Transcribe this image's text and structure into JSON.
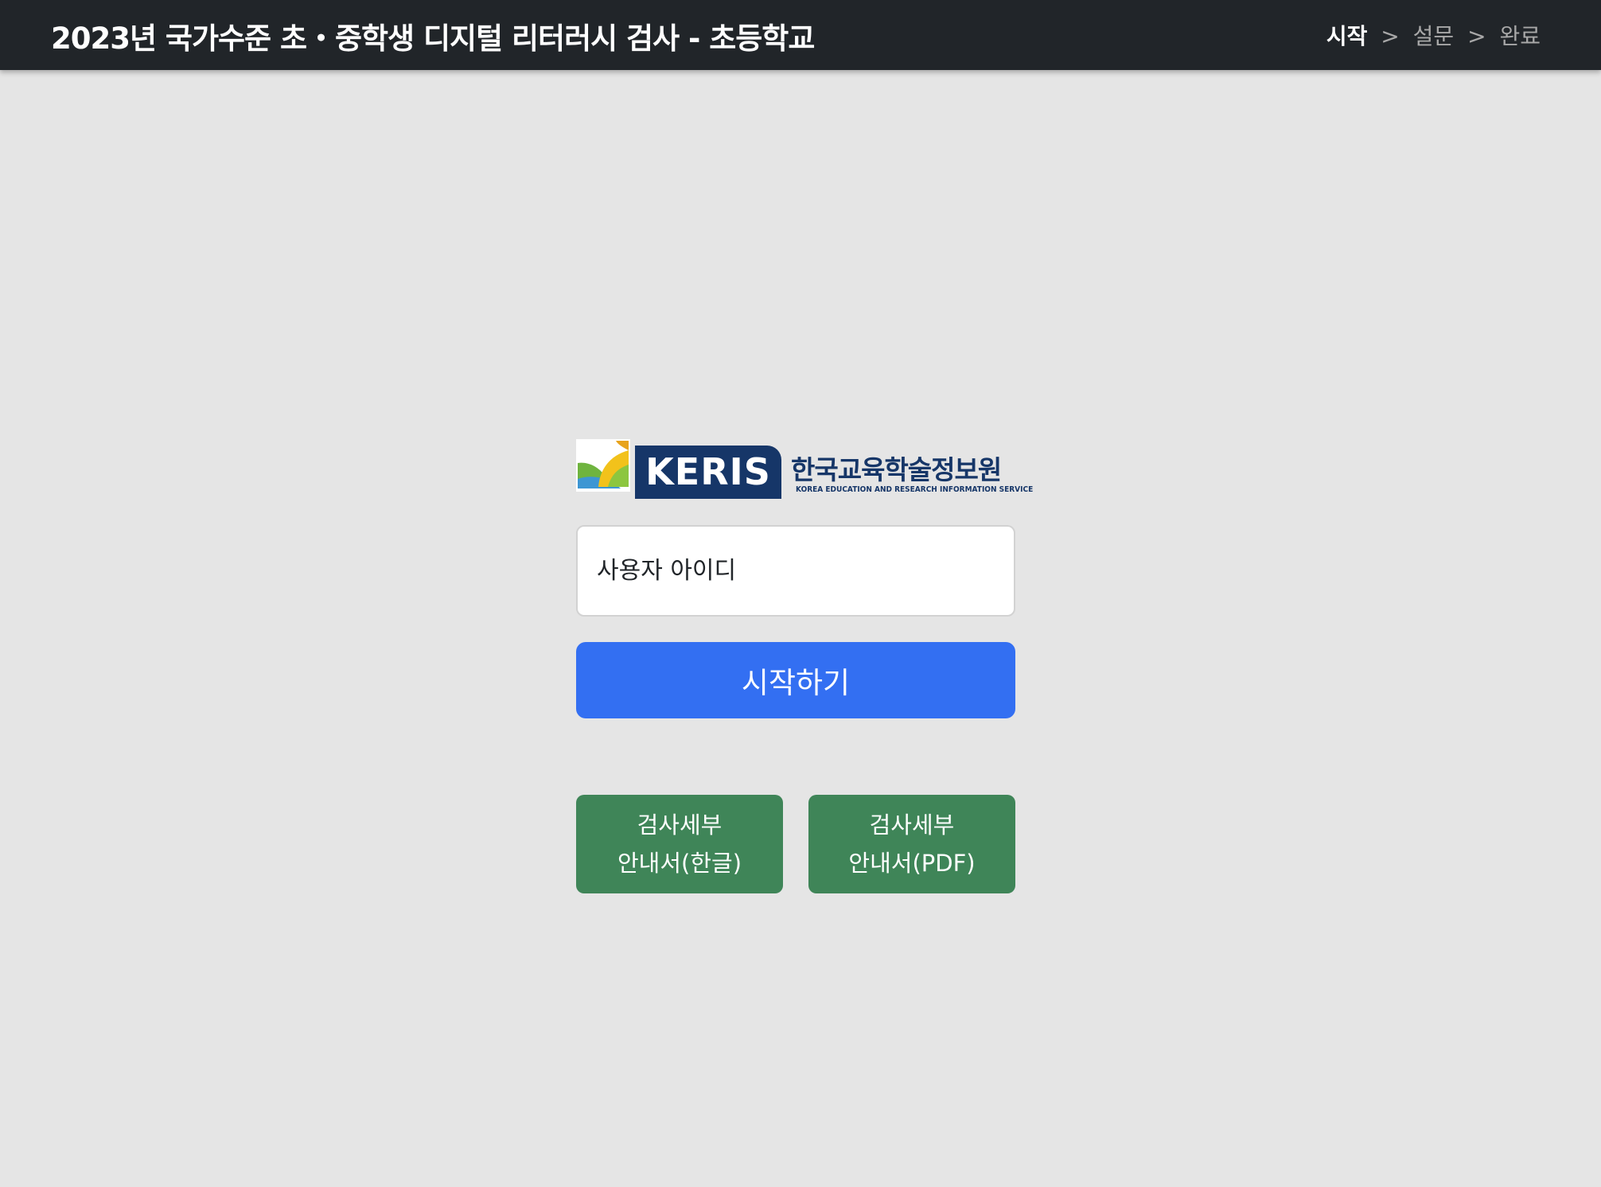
{
  "header": {
    "title": "2023년 국가수준 초・중학생 디지털 리터러시 검사 - 초등학교",
    "steps": {
      "current": "시작",
      "separator": ">",
      "second": "설문",
      "third": "완료"
    }
  },
  "logo": {
    "acronym": "KERIS",
    "korean_name": "한국교육학술정보원",
    "english_name": "KOREA EDUCATION AND RESEARCH INFORMATION SERVICE"
  },
  "login": {
    "user_id_placeholder": "사용자 아이디",
    "user_id_value": "",
    "start_label": "시작하기"
  },
  "guides": {
    "hangul": {
      "line1": "검사세부",
      "line2": "안내서(한글)"
    },
    "pdf": {
      "line1": "검사세부",
      "line2": "안내서(PDF)"
    }
  },
  "colors": {
    "header_bg": "#212529",
    "page_bg": "#e5e5e5",
    "primary_button": "#336ff2",
    "guide_button": "#3f8558",
    "logo_navy": "#163668"
  }
}
